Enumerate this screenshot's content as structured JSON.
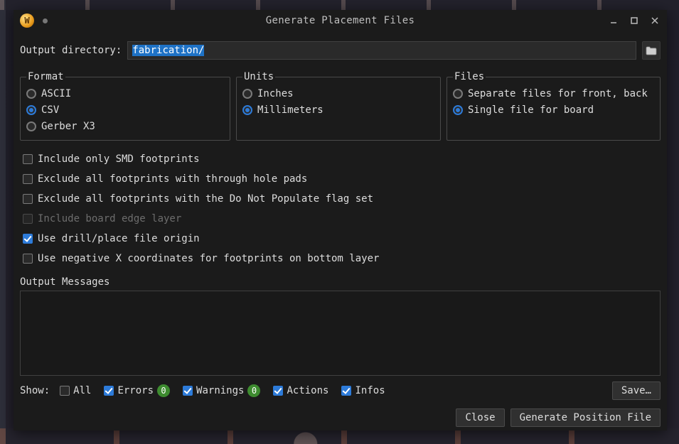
{
  "window": {
    "title": "Generate Placement Files",
    "app_icon_letter": "W"
  },
  "output": {
    "label": "Output directory:",
    "value": "fabrication/"
  },
  "format": {
    "legend": "Format",
    "options": {
      "ascii": "ASCII",
      "csv": "CSV",
      "gerber": "Gerber X3"
    },
    "selected": "csv"
  },
  "units": {
    "legend": "Units",
    "options": {
      "inches": "Inches",
      "mm": "Millimeters"
    },
    "selected": "mm"
  },
  "files": {
    "legend": "Files",
    "options": {
      "separate": "Separate files for front, back",
      "single": "Single file for board"
    },
    "selected": "single"
  },
  "checkboxes": {
    "only_smd": {
      "label": "Include only SMD footprints",
      "checked": false,
      "disabled": false
    },
    "excl_th": {
      "label": "Exclude all footprints with through hole pads",
      "checked": false,
      "disabled": false
    },
    "excl_dnp": {
      "label": "Exclude all footprints with the Do Not Populate flag set",
      "checked": false,
      "disabled": false
    },
    "edge": {
      "label": "Include board edge layer",
      "checked": false,
      "disabled": true
    },
    "drill_origin": {
      "label": "Use drill/place file origin",
      "checked": true,
      "disabled": false
    },
    "neg_x": {
      "label": "Use negative X coordinates for footprints on bottom layer",
      "checked": false,
      "disabled": false
    }
  },
  "messages": {
    "label": "Output Messages"
  },
  "show": {
    "label": "Show:",
    "all": {
      "label": "All",
      "checked": false
    },
    "errors": {
      "label": "Errors",
      "checked": true,
      "count": "0"
    },
    "warnings": {
      "label": "Warnings",
      "checked": true,
      "count": "0"
    },
    "actions": {
      "label": "Actions",
      "checked": true
    },
    "infos": {
      "label": "Infos",
      "checked": true
    },
    "save": "Save…"
  },
  "buttons": {
    "close": "Close",
    "generate": "Generate Position File"
  }
}
